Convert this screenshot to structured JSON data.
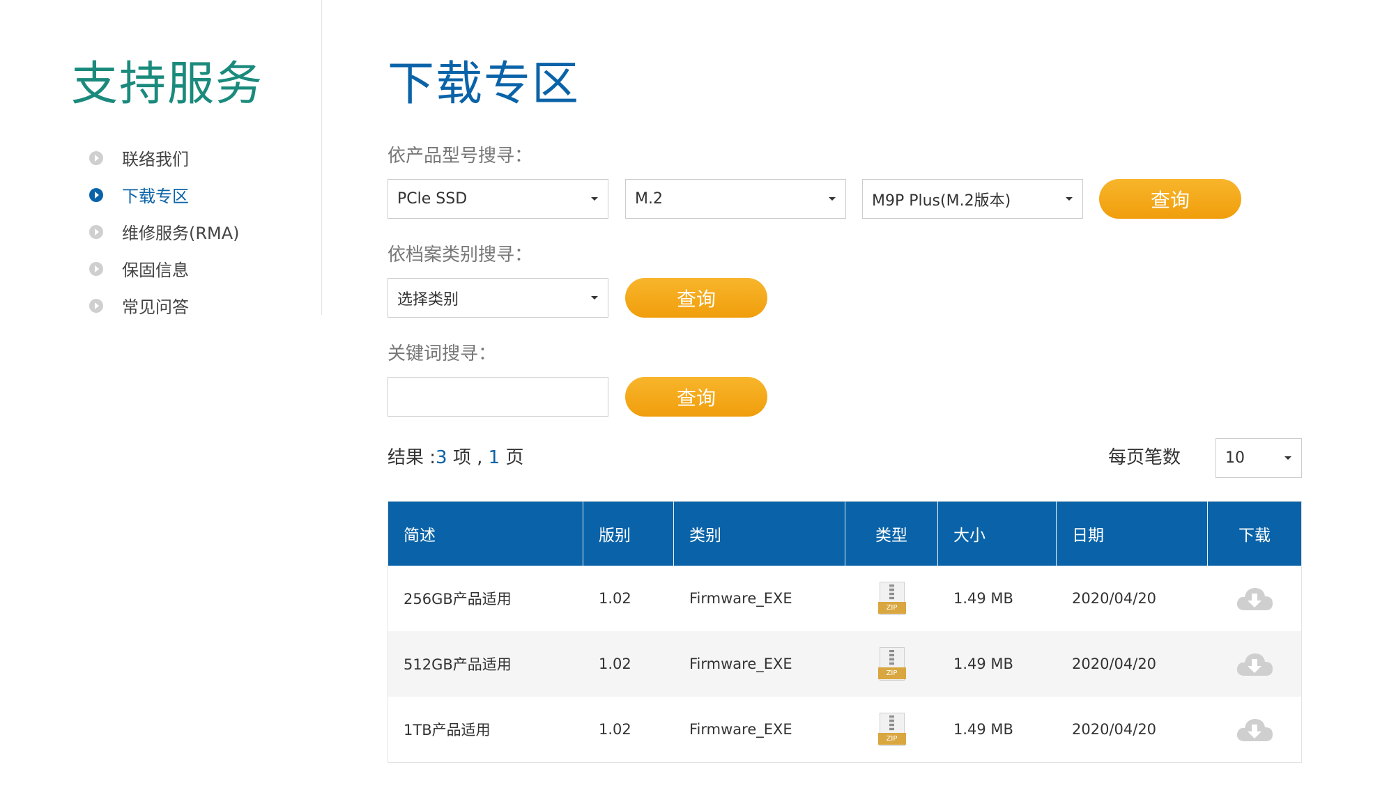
{
  "sidebar": {
    "title": "支持服务",
    "items": [
      {
        "label": "联络我们",
        "active": false
      },
      {
        "label": "下载专区",
        "active": true
      },
      {
        "label": "维修服务(RMA)",
        "active": false
      },
      {
        "label": "保固信息",
        "active": false
      },
      {
        "label": "常见问答",
        "active": false
      }
    ]
  },
  "main": {
    "title": "下载专区",
    "model_search": {
      "label": "依产品型号搜寻：",
      "select1": "PCle SSD",
      "select2": "M.2",
      "select3": "M9P Plus(M.2版本)",
      "button": "查询"
    },
    "category_search": {
      "label": "依档案类别搜寻：",
      "select": "选择类别",
      "button": "查询"
    },
    "keyword_search": {
      "label": "关键词搜寻：",
      "value": "",
      "placeholder": "",
      "button": "查询"
    },
    "result": {
      "prefix": "结果 :",
      "count": "3",
      "middle": " 项 , ",
      "pages": "1",
      "suffix": " 页"
    },
    "per_page": {
      "label": "每页笔数",
      "value": "10"
    },
    "table": {
      "headers": [
        "简述",
        "版别",
        "类别",
        "类型",
        "大小",
        "日期",
        "下载"
      ],
      "rows": [
        {
          "desc": "256GB产品适用",
          "version": "1.02",
          "category": "Firmware_EXE",
          "type_icon": "zip-file-icon",
          "type_tag": "ZIP",
          "size": "1.49 MB",
          "date": "2020/04/20",
          "download_icon": "cloud-download-icon"
        },
        {
          "desc": "512GB产品适用",
          "version": "1.02",
          "category": "Firmware_EXE",
          "type_icon": "zip-file-icon",
          "type_tag": "ZIP",
          "size": "1.49 MB",
          "date": "2020/04/20",
          "download_icon": "cloud-download-icon"
        },
        {
          "desc": "1TB产品适用",
          "version": "1.02",
          "category": "Firmware_EXE",
          "type_icon": "zip-file-icon",
          "type_tag": "ZIP",
          "size": "1.49 MB",
          "date": "2020/04/20",
          "download_icon": "cloud-download-icon"
        }
      ]
    }
  },
  "colors": {
    "brand_blue": "#0a63a8",
    "sidebar_title": "#1a8a7c",
    "button_orange": "#f5a81d"
  }
}
